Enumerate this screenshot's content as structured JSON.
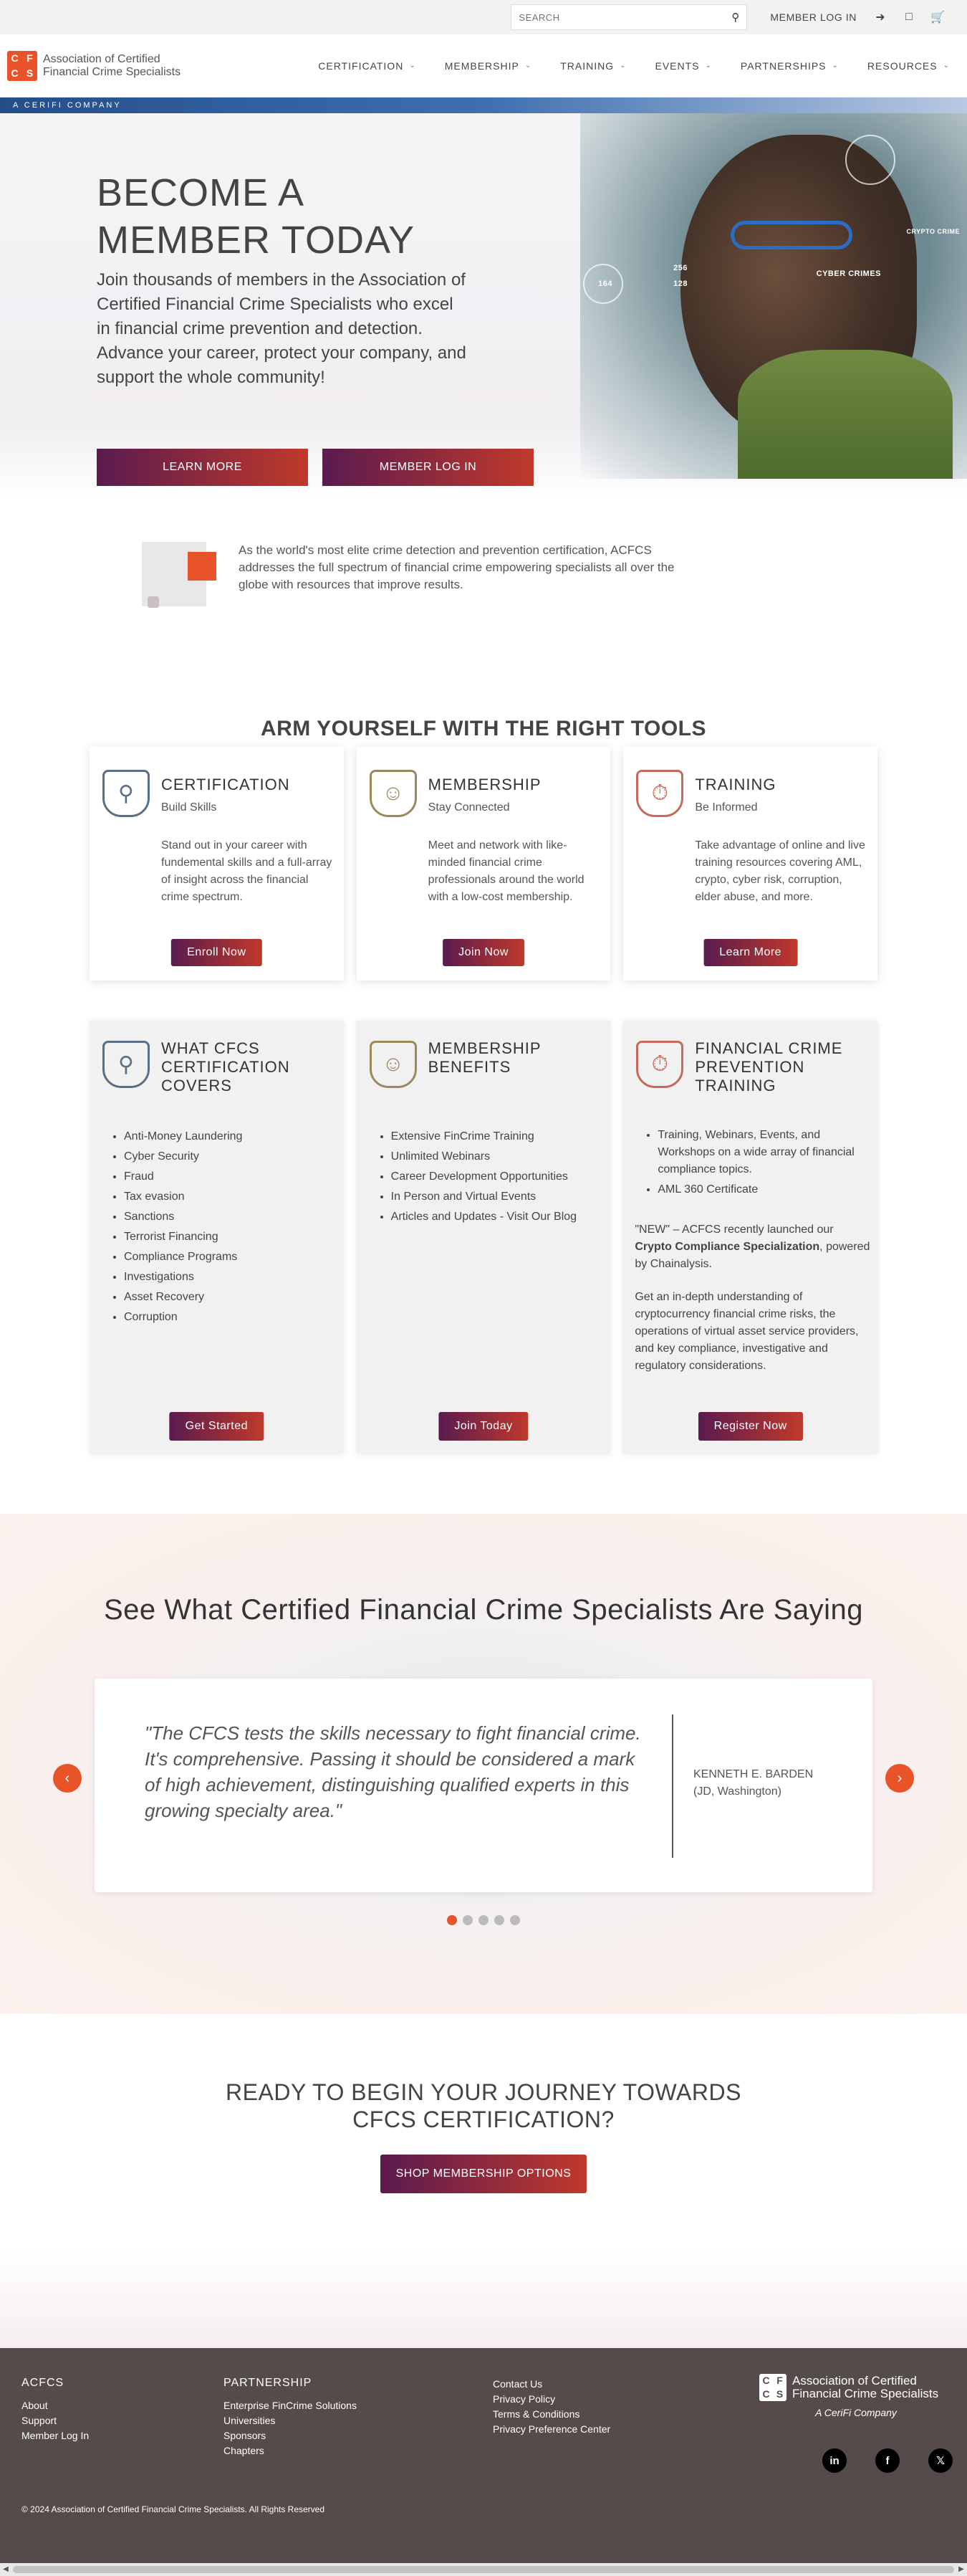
{
  "topbar": {
    "search_placeholder": "SEARCH",
    "member_login": "MEMBER LOG IN",
    "icons": [
      "login-icon",
      "account-icon",
      "cart-icon"
    ]
  },
  "header": {
    "logo_letters": [
      "C",
      "F",
      "C",
      "S"
    ],
    "logo_line1": "Association of Certified",
    "logo_line2": "Financial Crime Specialists",
    "nav": [
      {
        "label": "CERTIFICATION"
      },
      {
        "label": "MEMBERSHIP"
      },
      {
        "label": "TRAINING"
      },
      {
        "label": "EVENTS"
      },
      {
        "label": "PARTNERSHIPS"
      },
      {
        "label": "RESOURCES"
      }
    ]
  },
  "band": {
    "text": "A CERIFI COMPANY"
  },
  "hero": {
    "title_line1": "BECOME A",
    "title_line2": "MEMBER TODAY",
    "subtitle": "Join thousands of members in the Association of Certified Financial Crime Specialists who excel in financial crime prevention and detection. Advance your career, protect your company, and support the whole community!",
    "btn_learn": "LEARN MORE",
    "btn_login": "MEMBER LOG IN",
    "hud": {
      "cyber": "CYBER CRIMES",
      "n1": "256",
      "n2": "128",
      "n3": "164",
      "crypto": "CRYPTO CRIME"
    }
  },
  "intro": {
    "text": "As the world's most elite crime detection and prevention certification, ACFCS addresses the full spectrum of financial crime empowering specialists all over the globe with resources that improve results."
  },
  "tools": {
    "title": "ARM YOURSELF WITH THE RIGHT TOOLS",
    "cards": [
      {
        "title": "CERTIFICATION",
        "subtitle": "Build Skills",
        "text": "Stand out in your career with fundemental skills and a full-array of insight across the financial crime spectrum.",
        "button": "Enroll Now",
        "color": "#5a6f86"
      },
      {
        "title": "MEMBERSHIP",
        "subtitle": "Stay Connected",
        "text": "Meet and network with like-minded financial crime professionals around the world with a low-cost membership.",
        "button": "Join Now",
        "color": "#9a8a5c"
      },
      {
        "title": "TRAINING",
        "subtitle": "Be Informed",
        "text": "Take advantage of online and live training resources covering AML, crypto, cyber risk, corruption, elder abuse, and more.",
        "button": "Learn More",
        "color": "#c46b5b"
      }
    ]
  },
  "benefits": [
    {
      "title": "WHAT CFCS CERTIFICATION COVERS",
      "items": [
        "Anti-Money Laundering",
        "Cyber Security",
        "Fraud",
        "Tax evasion",
        "Sanctions",
        "Terrorist Financing",
        "Compliance Programs",
        "Investigations",
        "Asset Recovery",
        "Corruption"
      ],
      "button": "Get Started"
    },
    {
      "title": "MEMBERSHIP BENEFITS",
      "items": [
        "Extensive FinCrime Training",
        "Unlimited Webinars",
        "Career Development Opportunities",
        "In Person and Virtual Events",
        "Articles and Updates - Visit Our Blog"
      ],
      "button": "Join Today"
    },
    {
      "title": "FINANCIAL CRIME PREVENTION TRAINING",
      "items": [
        "Training, Webinars, Events, and Workshops on a wide array of financial compliance topics.",
        "AML 360 Certificate"
      ],
      "new_text_pre": "\"NEW\" – ACFCS recently launched our ",
      "new_text_bold": "Crypto Compliance Specialization",
      "new_text_post": ", powered by Chainalysis.",
      "extra": "Get an in-depth understanding of cryptocurrency financial crime risks, the operations of virtual asset service providers, and key compliance, investigative and regulatory considerations.",
      "button": "Register Now"
    }
  ],
  "testimonials": {
    "title": "See What Certified Financial Crime Specialists Are Saying",
    "quote": "\"The CFCS tests the skills necessary to fight financial crime. It's comprehensive. Passing it should be considered a mark of high achievement, distinguishing qualified experts in this growing specialty area.\"",
    "author_name": "KENNETH E. BARDEN",
    "author_meta": "(JD, Washington)",
    "slide_count": 5,
    "active_slide": 1
  },
  "ready": {
    "title_line1": "READY TO BEGIN YOUR JOURNEY TOWARDS",
    "title_line2": "CFCS CERTIFICATION?",
    "button": "SHOP MEMBERSHIP OPTIONS"
  },
  "footer": {
    "col1_title": "ACFCS",
    "col1_links": [
      "About",
      "Support",
      "Member Log In"
    ],
    "col2_title": "PARTNERSHIP",
    "col2_links": [
      "Enterprise FinCrime Solutions",
      "Universities",
      "Sponsors",
      "Chapters"
    ],
    "col3_links": [
      "Contact Us",
      "Privacy Policy",
      "Terms & Conditions",
      "Privacy Preference Center"
    ],
    "logo_line1": "Association of Certified",
    "logo_line2": "Financial Crime Specialists",
    "cerifi": "A CeriFi Company",
    "social": [
      "linkedin-icon",
      "facebook-icon",
      "x-icon"
    ],
    "copyright": "© 2024 Association of Certified Financial Crime Specialists. All Rights Reserved"
  },
  "colors": {
    "accent": "#e8532a",
    "brand_dark": "#5a1b4e",
    "brand_red": "#c0392b",
    "footer_bg": "#554b4b"
  }
}
